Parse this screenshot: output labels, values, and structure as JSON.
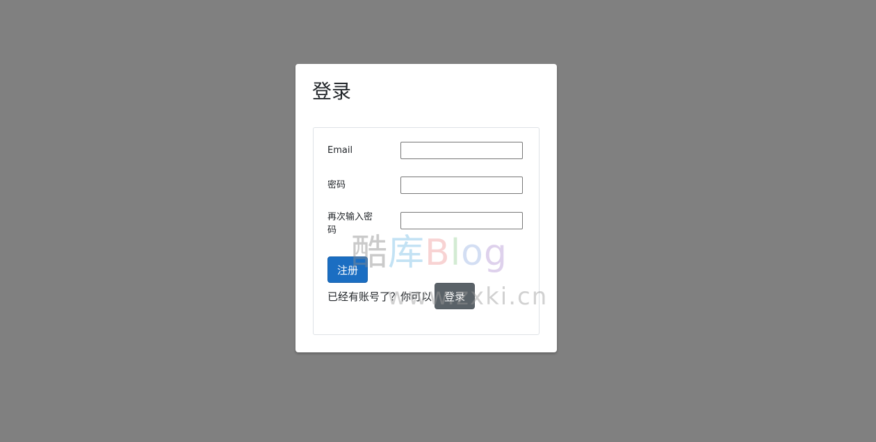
{
  "modal": {
    "title": "登录"
  },
  "form": {
    "email_label": "Email",
    "email_value": "",
    "password_label": "密码",
    "password_value": "",
    "confirm_label": "再次输入密码",
    "confirm_value": "",
    "register_button": "注册",
    "login_prompt": "已经有账号了？你可以",
    "login_button": "登录"
  },
  "watermark": {
    "part1": "酷",
    "part2": "库",
    "part3": "B",
    "part4": "l",
    "part5": "o",
    "part6": "g",
    "bottom": "www.zxki.cn"
  },
  "colors": {
    "overlay": "#808080",
    "primary": "#1b6ec2",
    "secondary": "#5a6268"
  }
}
